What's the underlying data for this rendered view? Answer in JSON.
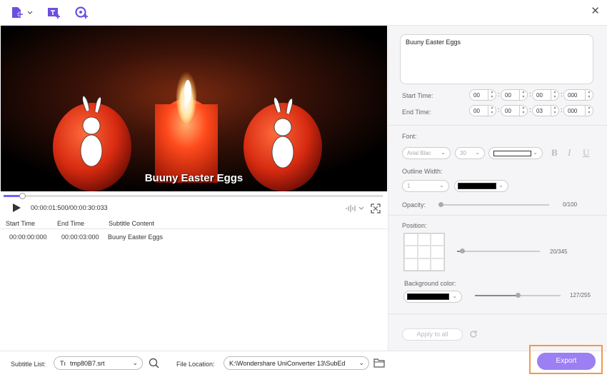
{
  "toolbar": {
    "icons": [
      "add-file-icon",
      "add-subtitle-icon",
      "add-recording-icon"
    ],
    "close_glyph": "✕"
  },
  "video": {
    "subtitle_overlay": "Buuny Easter Eggs",
    "progress": 0.047
  },
  "player": {
    "time": "00:00:01:500/00:00:30:033"
  },
  "subtitle_table": {
    "headers": [
      "Start Time",
      "End Time",
      "Subtitle Content"
    ],
    "rows": [
      {
        "start": "00:00:00:000",
        "end": "00:00:03:000",
        "content": "Buuny Easter Eggs"
      }
    ]
  },
  "editor": {
    "text": "Buuny Easter Eggs",
    "start_label": "Start Time:",
    "end_label": "End Time:",
    "start": [
      "00",
      "00",
      "00",
      "000"
    ],
    "end": [
      "00",
      "00",
      "03",
      "000"
    ]
  },
  "font": {
    "label": "Font:",
    "family": "Arial Blac",
    "size": "30",
    "color": "#ffffff",
    "bold": "B",
    "italic": "I",
    "underline": "U"
  },
  "outline": {
    "label": "Outline Width:",
    "width": "1",
    "color": "#000000"
  },
  "opacity": {
    "label": "Opacity:",
    "value": "0/100",
    "fraction": 0
  },
  "position": {
    "label": "Position:",
    "value": "20/345",
    "fraction": 0.058
  },
  "background": {
    "label": "Background color:",
    "color": "#000000",
    "value": "127/255",
    "fraction": 0.498
  },
  "apply_all": "Apply to all",
  "bottom": {
    "subtitle_list_label": "Subtitle List:",
    "subtitle_file": "tmp80B7.srt",
    "subtitle_file_glyph": "Tı",
    "file_location_label": "File Location:",
    "file_location": "K:\\Wondershare UniConverter 13\\SubEd",
    "export": "Export"
  },
  "colors": {
    "accent": "#6c63ff",
    "export_bg": "#9b7ff3",
    "highlight": "#f29a4a"
  }
}
